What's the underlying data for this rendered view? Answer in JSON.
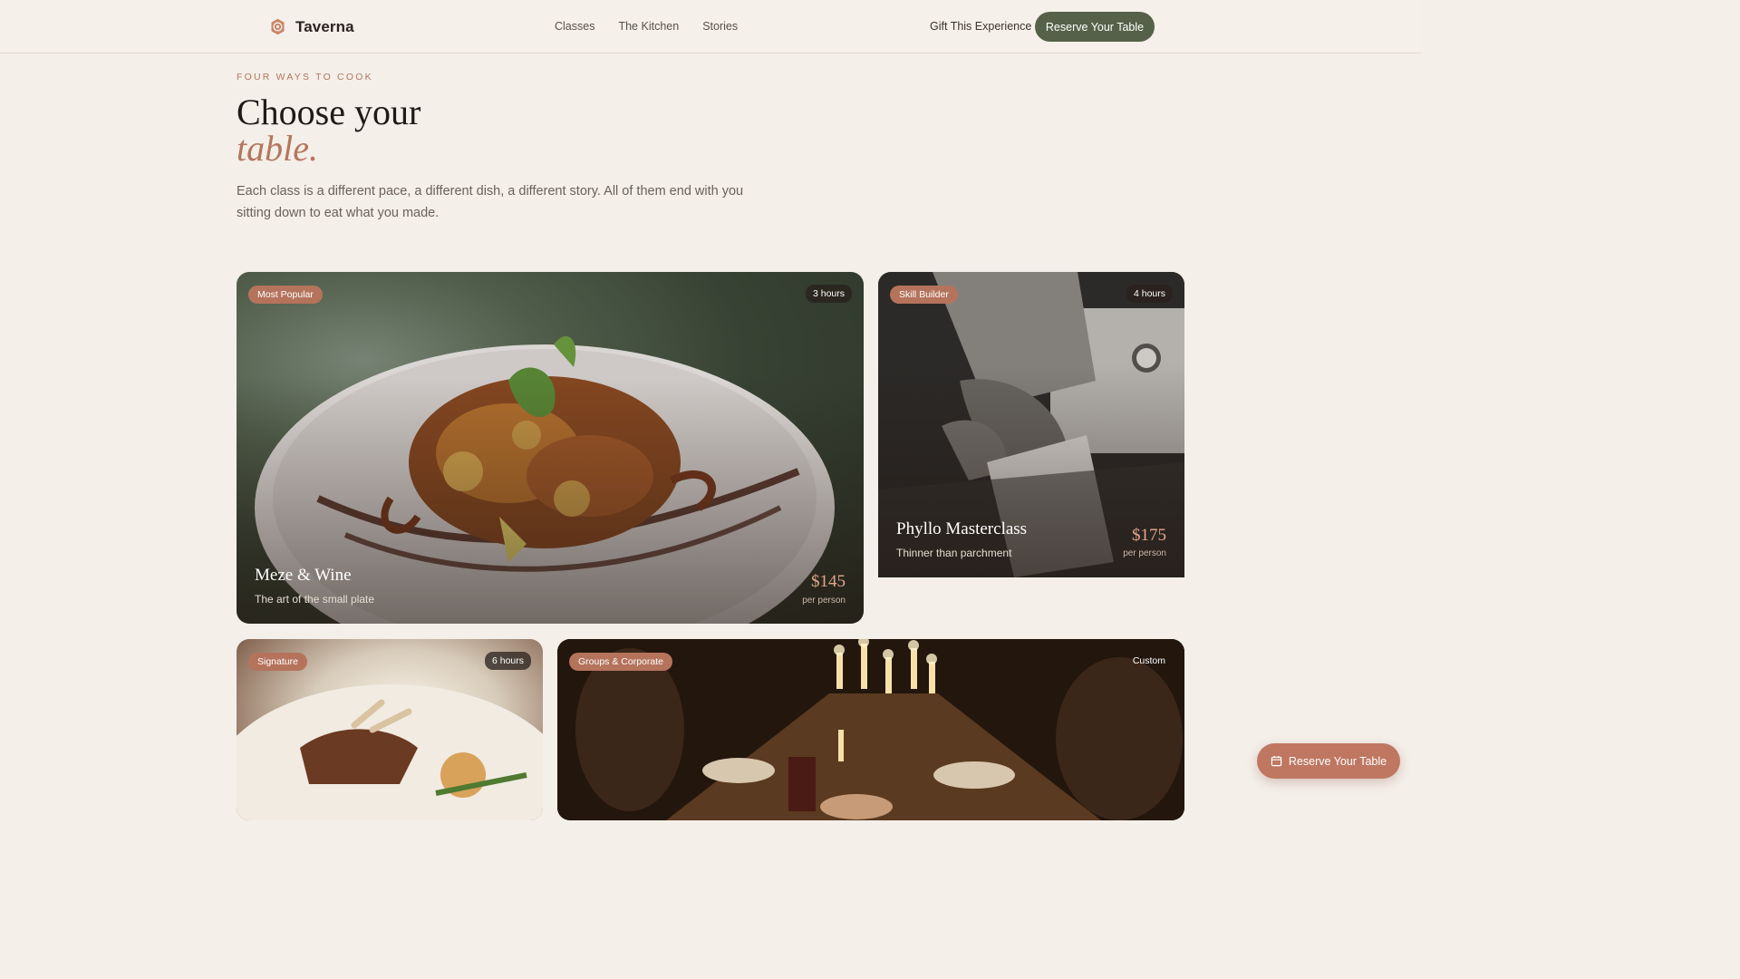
{
  "nav": {
    "brand": "Taverna",
    "links": [
      "Classes",
      "The Kitchen",
      "Stories"
    ],
    "gift": "Gift This Experience",
    "reserve": "Reserve Your Table"
  },
  "hero": {
    "eyebrow": "FOUR WAYS TO COOK",
    "title_line1": "Choose your",
    "title_line2": "table.",
    "lede": "Each class is a different pace, a different dish, a different story. All of them end with you sitting down to eat what you made."
  },
  "cards": [
    {
      "tag": "Most Popular",
      "duration": "3 hours",
      "title": "Meze & Wine",
      "subtitle": "The art of the small plate",
      "price": "$145",
      "per": "per person"
    },
    {
      "tag": "Skill Builder",
      "duration": "4 hours",
      "title": "Phyllo Masterclass",
      "subtitle": "Thinner than parchment",
      "price": "$175",
      "per": "per person"
    },
    {
      "tag": "Signature",
      "duration": "6 hours"
    },
    {
      "tag": "Groups & Corporate",
      "duration": "Custom"
    }
  ],
  "floating": {
    "label": "Reserve Your Table",
    "icon": "calendar-icon"
  },
  "colors": {
    "accent": "#b5765c",
    "primary_button": "#556148",
    "background": "#f4efe9"
  }
}
